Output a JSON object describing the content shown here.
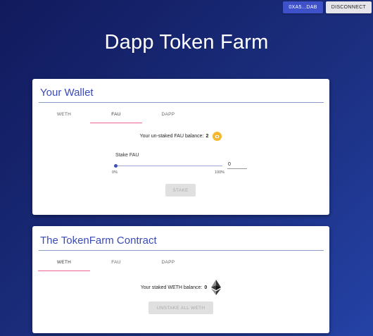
{
  "header": {
    "account_label": "0XA5...DAB",
    "disconnect_label": "DISCONNECT",
    "title": "Dapp Token Farm"
  },
  "wallet": {
    "title": "Your Wallet",
    "tabs": [
      {
        "label": "WETH",
        "active": false
      },
      {
        "label": "FAU",
        "active": true
      },
      {
        "label": "DAPP",
        "active": false
      }
    ],
    "balance_label": "Your un-staked FAU balance:",
    "balance_value": "2",
    "balance_icon": "fau-token-icon",
    "stake_label": "Stake FAU",
    "slider_min_label": "0%",
    "slider_max_label": "100%",
    "slider_value_fraction": 0,
    "amount_value": "0",
    "stake_button_label": "STAKE"
  },
  "contract": {
    "title": "The TokenFarm Contract",
    "tabs": [
      {
        "label": "WETH",
        "active": true
      },
      {
        "label": "FAU",
        "active": false
      },
      {
        "label": "DAPP",
        "active": false
      }
    ],
    "balance_label": "Your staked WETH balance:",
    "balance_value": "0",
    "balance_icon": "eth-icon",
    "unstake_button_label": "UNSTAKE ALL WETH"
  },
  "colors": {
    "accent": "#3f51b5",
    "tab_indicator": "#f06292",
    "fau_token": "#f5b82e"
  }
}
